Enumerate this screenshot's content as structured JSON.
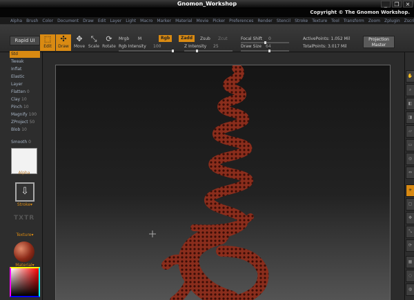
{
  "window": {
    "title": "Gnomon_Workshop",
    "buttons": [
      "_",
      "❐",
      "✕"
    ]
  },
  "copyright": "Copyright © The Gnomon Workshop.",
  "menus": [
    "Alpha",
    "Brush",
    "Color",
    "Document",
    "Draw",
    "Edit",
    "Layer",
    "Light",
    "Macro",
    "Marker",
    "Material",
    "Movie",
    "Picker",
    "Preferences",
    "Render",
    "Stencil",
    "Stroke",
    "Texture",
    "Tool",
    "Transform",
    "Zoom",
    "Zplugin",
    "Zscript"
  ],
  "toolbar": {
    "rapid_ui": "Rapid UI",
    "edit": "Edit",
    "draw": "Draw",
    "move": "Move",
    "scale": "Scale",
    "rotate": "Rotate",
    "mrgb": "Mrgb",
    "m": "M",
    "rgb": "Rgb",
    "zadd": "Zadd",
    "zsub": "Zsub",
    "zcut": "Zcut",
    "rgb_intensity_label": "Rgb Intensity",
    "rgb_intensity_value": "100",
    "rgb_intensity_level": 1.0,
    "z_intensity_label": "Z Intensity",
    "z_intensity_value": "25",
    "z_intensity_level": 0.25,
    "focal_shift_label": "Focal Shift",
    "focal_shift_value": "0",
    "draw_size_label": "Draw Size",
    "draw_size_value": "64",
    "active_points": "ActivePoints: 1.052 Mil",
    "total_points": "TotalPoints: 3.017 Mil",
    "projection_master": "Projection Master"
  },
  "brushes": [
    {
      "label": "Std",
      "selected": true
    },
    {
      "label": "Tweak"
    },
    {
      "label": "Inflat"
    },
    {
      "label": "Elastic"
    },
    {
      "label": "Layer"
    },
    {
      "label": "Flatten",
      "value": "0"
    },
    {
      "label": "Clay",
      "value": "10"
    },
    {
      "label": "Pinch",
      "value": "10"
    },
    {
      "label": "Magnify",
      "value": "100"
    },
    {
      "label": "ZProject",
      "value": "50"
    },
    {
      "label": "Blob",
      "value": "10"
    },
    {
      "label": "Smooth",
      "value": "0"
    }
  ],
  "left": {
    "alpha_label": "Alpha",
    "stroke_label": "Stroke",
    "texture_logo": "TXTR",
    "texture_label": "Texture",
    "material_label": "Material"
  },
  "right_buttons": [
    "Scroll",
    "Zoom",
    "Actual",
    "AAHalf",
    "Persp",
    "Floor",
    "Local",
    "L.Sym",
    "Xyz",
    "Frame",
    "Move",
    "Scale",
    "Rotate",
    "Poly",
    "Transp",
    "Ghost"
  ],
  "colors": {
    "accent": "#d98a12",
    "model": "#8a2d1c"
  }
}
